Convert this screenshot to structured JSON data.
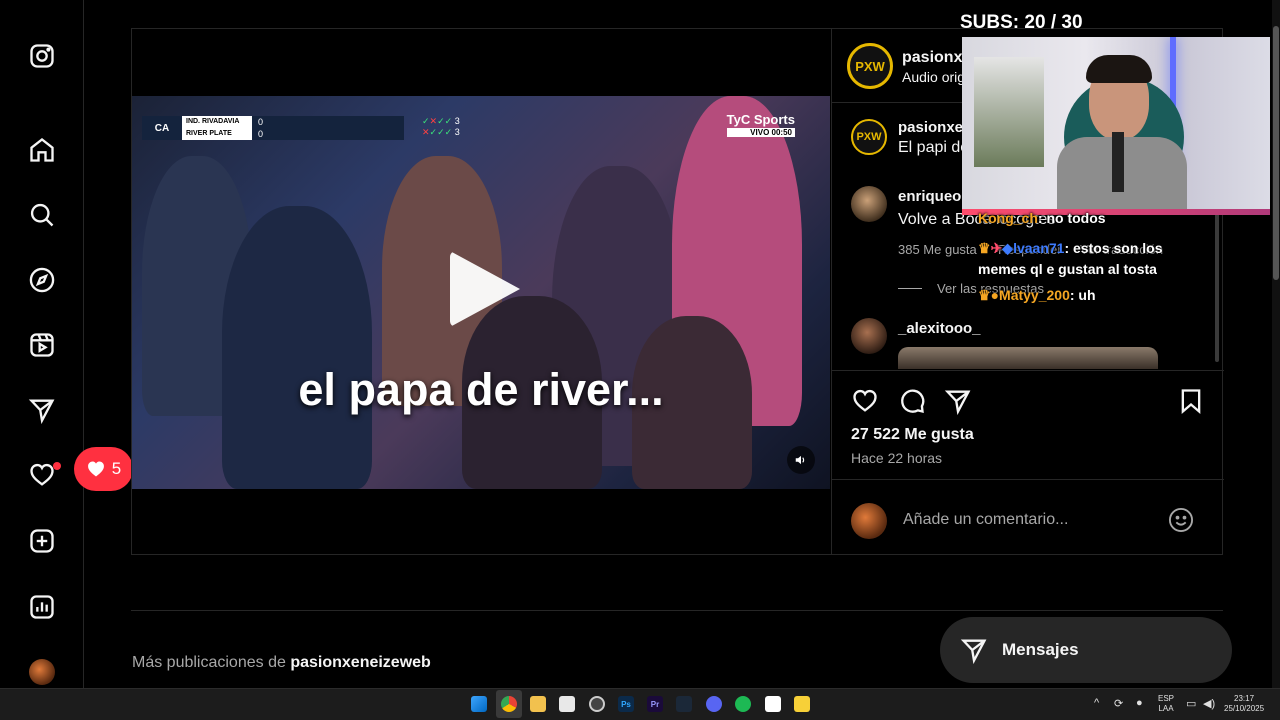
{
  "stream_overlay": {
    "subs_label": "SUBS:",
    "subs_count": "20",
    "subs_sep": "/",
    "subs_goal": "30",
    "chat": [
      {
        "user": "Kong_ch",
        "message": "no todos"
      },
      {
        "user": "lvaan71",
        "message": "estos son los memes ql e gustan al tosta"
      },
      {
        "user": "Matyy_200",
        "message": "uh"
      }
    ]
  },
  "sidebar": {
    "notifications_count": "5"
  },
  "video": {
    "caption": "el papa de river...",
    "scoreboard": {
      "channel": "CA",
      "team1": "IND. RIVADAVIA",
      "team2": "RIVER PLATE",
      "score1": "0",
      "score2": "0",
      "pens1": "3",
      "pens2": "3"
    },
    "broadcaster": "TyC Sports",
    "broadcaster_live": "VIVO",
    "broadcaster_time": "00:50"
  },
  "post_header": {
    "badge": "PXW",
    "username": "pasionxe",
    "audio": "Audio orig"
  },
  "comments": [
    {
      "badge": "PXW",
      "username": "pasionxe",
      "text": "El papi de"
    },
    {
      "username": "enriqueo",
      "text": "Volve a Boca locogtes",
      "likes": "385 Me gusta",
      "reply": "Responder",
      "translate": "Ver traducción",
      "view_replies": "Ver las respuestas"
    },
    {
      "username": "_alexitooo_"
    }
  ],
  "post_footer": {
    "likes": "27 522 Me gusta",
    "time": "Hace 22 horas",
    "comment_placeholder": "Añade un comentario..."
  },
  "more_posts": {
    "prefix": "Más publicaciones de",
    "username": "pasionxeneizeweb"
  },
  "messages_button": "Mensajes",
  "taskbar": {
    "lang_top": "ESP",
    "lang_bottom": "LAA",
    "time": "23:17",
    "date": "25/10/2025"
  },
  "colors": {
    "notification_red": "#ff3040",
    "subs_color": "#ffffff",
    "chat_user_orange": "#f5a623",
    "chat_user_blue": "#3d7bff",
    "pxw_gold": "#e6b800"
  },
  "icons": [
    "instagram-icon",
    "home-icon",
    "search-icon",
    "explore-icon",
    "reels-icon",
    "direct-icon",
    "heart-icon",
    "create-icon",
    "dashboard-icon",
    "play-icon",
    "volume-icon",
    "like-icon",
    "comment-icon",
    "share-icon",
    "save-icon",
    "emoji-icon",
    "messages-icon",
    "windows-start-icon"
  ]
}
